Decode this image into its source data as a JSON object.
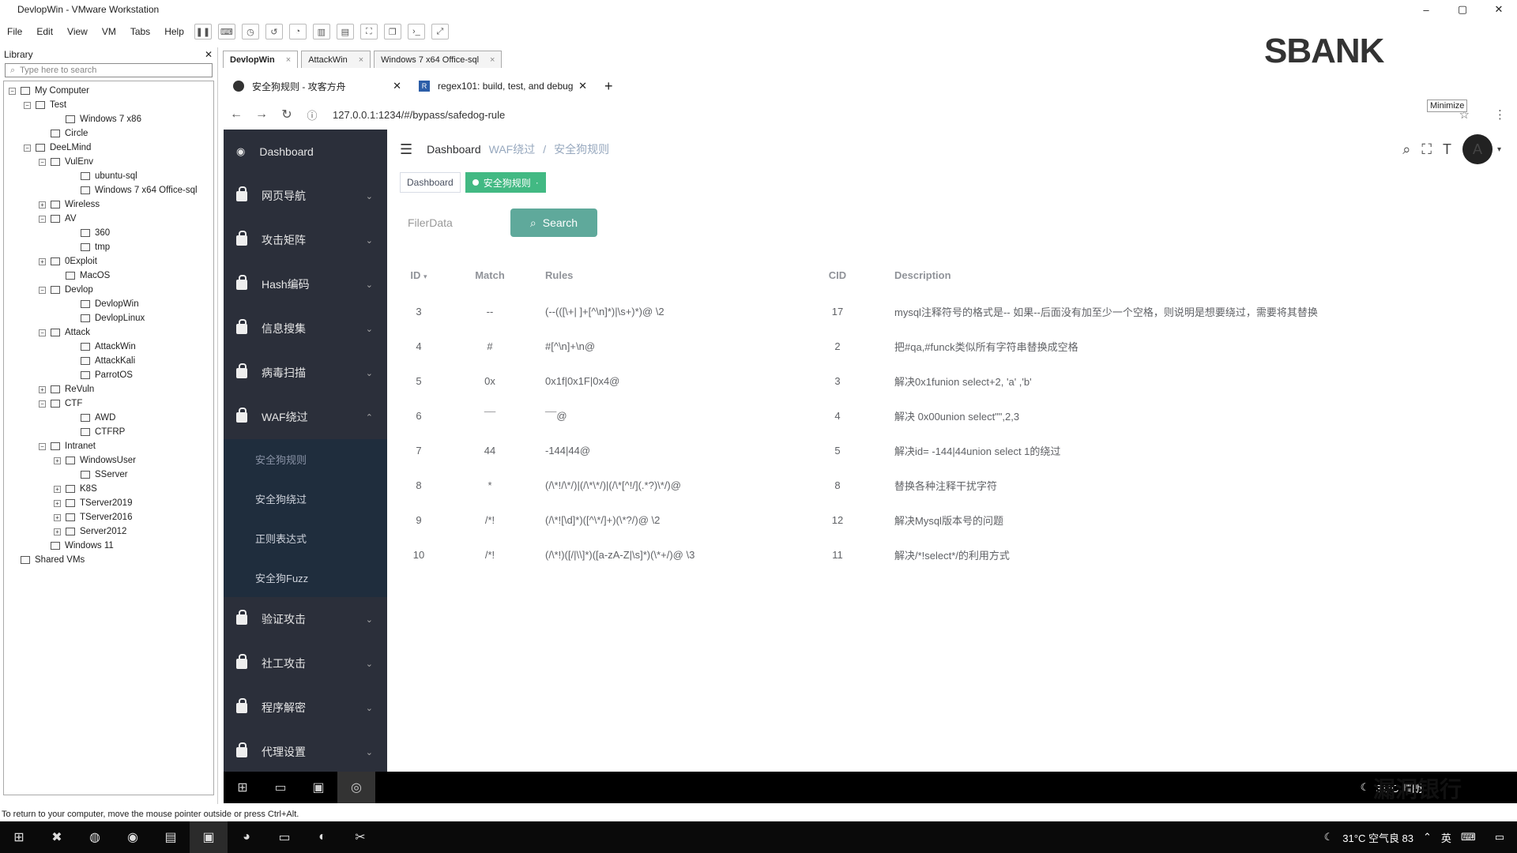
{
  "window": {
    "title": "DevlopWin - VMware Workstation",
    "controls": [
      "–",
      "▢",
      "✕"
    ]
  },
  "menu": [
    "File",
    "Edit",
    "View",
    "VM",
    "Tabs",
    "Help"
  ],
  "library": {
    "title": "Library",
    "search_placeholder": "Type here to search",
    "tree": [
      {
        "label": "My Computer",
        "indent": 0,
        "toggle": "−"
      },
      {
        "label": "Test",
        "indent": 1,
        "toggle": "−"
      },
      {
        "label": "Windows 7 x86",
        "indent": 3,
        "toggle": ""
      },
      {
        "label": "Circle",
        "indent": 2,
        "toggle": ""
      },
      {
        "label": "DeeLMind",
        "indent": 1,
        "toggle": "−"
      },
      {
        "label": "VulEnv",
        "indent": 2,
        "toggle": "−"
      },
      {
        "label": "ubuntu-sql",
        "indent": 4,
        "toggle": ""
      },
      {
        "label": "Windows 7 x64 Office-sql",
        "indent": 4,
        "toggle": ""
      },
      {
        "label": "Wireless",
        "indent": 2,
        "toggle": "+"
      },
      {
        "label": "AV",
        "indent": 2,
        "toggle": "−"
      },
      {
        "label": "360",
        "indent": 4,
        "toggle": ""
      },
      {
        "label": "tmp",
        "indent": 4,
        "toggle": ""
      },
      {
        "label": "0Exploit",
        "indent": 2,
        "toggle": "+"
      },
      {
        "label": "MacOS",
        "indent": 3,
        "toggle": ""
      },
      {
        "label": "Devlop",
        "indent": 2,
        "toggle": "−"
      },
      {
        "label": "DevlopWin",
        "indent": 4,
        "toggle": ""
      },
      {
        "label": "DevlopLinux",
        "indent": 4,
        "toggle": ""
      },
      {
        "label": "Attack",
        "indent": 2,
        "toggle": "−"
      },
      {
        "label": "AttackWin",
        "indent": 4,
        "toggle": ""
      },
      {
        "label": "AttackKali",
        "indent": 4,
        "toggle": ""
      },
      {
        "label": "ParrotOS",
        "indent": 4,
        "toggle": ""
      },
      {
        "label": "ReVuln",
        "indent": 2,
        "toggle": "+"
      },
      {
        "label": "CTF",
        "indent": 2,
        "toggle": "−"
      },
      {
        "label": "AWD",
        "indent": 4,
        "toggle": ""
      },
      {
        "label": "CTFRP",
        "indent": 4,
        "toggle": ""
      },
      {
        "label": "Intranet",
        "indent": 2,
        "toggle": "−"
      },
      {
        "label": "WindowsUser",
        "indent": 3,
        "toggle": "+"
      },
      {
        "label": "SServer",
        "indent": 4,
        "toggle": ""
      },
      {
        "label": "K8S",
        "indent": 3,
        "toggle": "+"
      },
      {
        "label": "TServer2019",
        "indent": 3,
        "toggle": "+"
      },
      {
        "label": "TServer2016",
        "indent": 3,
        "toggle": "+"
      },
      {
        "label": "Server2012",
        "indent": 3,
        "toggle": "+"
      },
      {
        "label": "Windows 11",
        "indent": 2,
        "toggle": ""
      },
      {
        "label": "Shared VMs",
        "indent": 0,
        "toggle": ""
      }
    ]
  },
  "vm_tabs": [
    {
      "label": "DevlopWin",
      "active": true
    },
    {
      "label": "AttackWin",
      "active": false
    },
    {
      "label": "Windows 7 x64 Office-sql",
      "active": false
    }
  ],
  "browser": {
    "tabs": [
      {
        "label": "安全狗规则 - 攻客方舟",
        "active": true
      },
      {
        "label": "regex101: build, test, and debug",
        "active": false
      }
    ],
    "new_tab": "+",
    "url": "127.0.0.1:1234/#/bypass/safedog-rule"
  },
  "sidebar": {
    "items": [
      {
        "label": "Dashboard",
        "chevron": ""
      },
      {
        "label": "网页导航",
        "chevron": "⌄"
      },
      {
        "label": "攻击矩阵",
        "chevron": "⌄"
      },
      {
        "label": "Hash编码",
        "chevron": "⌄"
      },
      {
        "label": "信息搜集",
        "chevron": "⌄"
      },
      {
        "label": "病毒扫描",
        "chevron": "⌄"
      },
      {
        "label": "WAF绕过",
        "chevron": "⌃"
      }
    ],
    "sub_items": [
      "安全狗规则",
      "安全狗绕过",
      "正则表达式",
      "安全狗Fuzz"
    ],
    "items_after": [
      {
        "label": "验证攻击",
        "chevron": "⌄"
      },
      {
        "label": "社工攻击",
        "chevron": "⌄"
      },
      {
        "label": "程序解密",
        "chevron": "⌄"
      },
      {
        "label": "代理设置",
        "chevron": "⌄"
      }
    ]
  },
  "header": {
    "breadcrumb": [
      "Dashboard",
      "WAF绕过",
      "安全狗规则"
    ],
    "avatar_text": "A"
  },
  "tags": [
    {
      "label": "Dashboard",
      "active": false
    },
    {
      "label": "安全狗规则",
      "active": true
    }
  ],
  "filter": {
    "placeholder": "FilerData",
    "search_label": "Search"
  },
  "table": {
    "columns": [
      "ID",
      "Match",
      "Rules",
      "CID",
      "Description"
    ],
    "rows": [
      {
        "id": "3",
        "match": "--",
        "rules": "(--(([\\+| ]+[^\\n]*)|\\s+)*)@ \\2",
        "cid": "17",
        "desc": "mysql注释符号的格式是-- 如果--后面没有加至少一个空格，则说明是想要绕过，需要将其替换"
      },
      {
        "id": "4",
        "match": "#",
        "rules": "#[^\\n]+\\n@",
        "cid": "2",
        "desc": "把#qa,#funck类似所有字符串替换成空格"
      },
      {
        "id": "5",
        "match": "0x",
        "rules": "0x1f|0x1F|0x4@",
        "cid": "3",
        "desc": "解决0x1funion select+2, 'a' ,'b'"
      },
      {
        "id": "6",
        "match": "¯¯",
        "rules": "¯¯@",
        "cid": "4",
        "desc": "解决 0x00union select\"\",2,3"
      },
      {
        "id": "7",
        "match": "44",
        "rules": "-144|44@",
        "cid": "5",
        "desc": "解决id= -144|44union select 1的绕过"
      },
      {
        "id": "8",
        "match": "*",
        "rules": "(/\\*!/\\*/)|(/\\*\\*/)|(/\\*[^!/](.*?)\\*/)@",
        "cid": "8",
        "desc": "替换各种注释干扰字符"
      },
      {
        "id": "9",
        "match": "/*!",
        "rules": "(/\\*![\\d]*)([^\\*/]+)(\\*?/)@ \\2",
        "cid": "12",
        "desc": "解决Mysql版本号的问题"
      },
      {
        "id": "10",
        "match": "/*!",
        "rules": "(/\\*!)([/|\\\\]*)([a-zA-Z|\\s]*)(\\*+/)@ \\3",
        "cid": "11",
        "desc": "解决/*!select*/的利用方式"
      }
    ]
  },
  "guest_tray": {
    "weather": "31°C 晴朗"
  },
  "host_tray": {
    "weather": "31°C 空气良 83",
    "lang": "英"
  },
  "status_text": "To return to your computer, move the mouse pointer outside or press Ctrl+Alt.",
  "tooltip": "Minimize",
  "watermark_top": "SBANK",
  "watermark_bottom": "漏洞银行"
}
